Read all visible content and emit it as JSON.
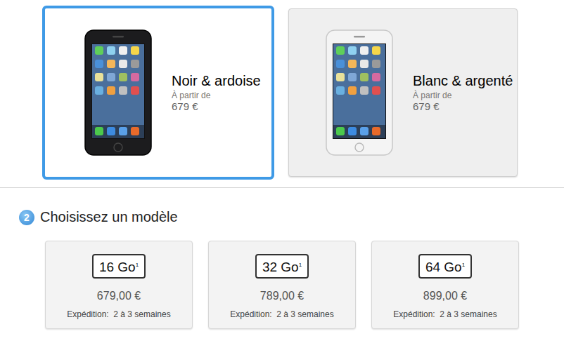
{
  "colors": [
    {
      "name": "Noir & ardoise",
      "from_label": "À partir de",
      "price": "679 €",
      "selected": true,
      "color": "#1c1c1e"
    },
    {
      "name": "Blanc & argenté",
      "from_label": "À partir de",
      "price": "679 €",
      "selected": false,
      "color": "#f4f4f4"
    }
  ],
  "step": {
    "number": "2",
    "title": "Choisissez un modèle"
  },
  "models": [
    {
      "capacity": "16 Go",
      "note": "1",
      "price": "679,00 €",
      "shipping": "Expédition:  2 à 3 semaines"
    },
    {
      "capacity": "32 Go",
      "note": "1",
      "price": "789,00 €",
      "shipping": "Expédition:  2 à 3 semaines"
    },
    {
      "capacity": "64 Go",
      "note": "1",
      "price": "899,00 €",
      "shipping": "Expédition:  2 à 3 semaines"
    }
  ]
}
